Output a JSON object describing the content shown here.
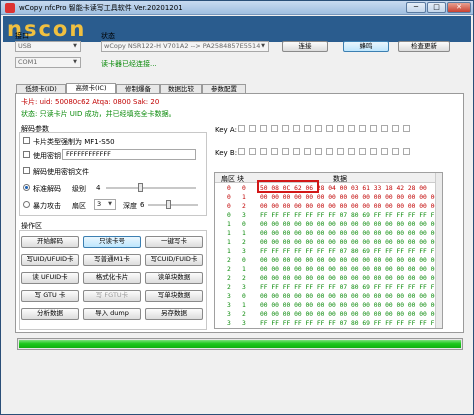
{
  "window": {
    "title": "wCopy nfcPro 智能卡读写工具软件  Ver.20201201",
    "minimize": "─",
    "maximize": "□",
    "close": "✕"
  },
  "banner": {
    "logo": "nscon"
  },
  "connection": {
    "port_label": "接口",
    "port_value": "USB",
    "com_value": "COM1",
    "status_label": "状态",
    "reader_value": "wCopy NSR122-H V701A2 --> PA2584857E5514",
    "reader_status": "读卡器已经连接...",
    "connect_label": "连接",
    "beep_label": "蜂鸣",
    "update_label": "检查更新"
  },
  "tabs": [
    "低频卡(ID)",
    "高频卡(IC)",
    "修制爆备",
    "数据比较",
    "参数配置"
  ],
  "card_info": {
    "line1": "卡片: uid: 50080c62  Atqa: 0800  Sak: 20",
    "line2": "状态: 只读卡片 UID 成功，并已经填充全卡数据。"
  },
  "decode_params": {
    "title": "解码参数",
    "opt1": "卡片类型强制为 MF1-S50",
    "opt2": "使用密钥",
    "key_value": "FFFFFFFFFFFF",
    "opt3": "解码使用密钥文件",
    "mode1": "标准解码",
    "level_label": "级别",
    "level_value": "4",
    "mode2": "暴力攻击",
    "sector_label": "扇区",
    "sector_value": "3",
    "depth_label": "深度",
    "depth_value": "6"
  },
  "operations": {
    "title": "操作区",
    "buttons": [
      [
        "开始解码",
        "只读卡号",
        "一键写卡"
      ],
      [
        "写UID/UFUID卡",
        "写普通M1卡",
        "写CUID/FUID卡"
      ],
      [
        "读 UFUID卡",
        "格式化卡片",
        "读单块数据"
      ],
      [
        "写 GTU 卡",
        "写 FGTU卡",
        "写单块数据"
      ],
      [
        "分析数据",
        "导入 dump",
        "另存数据"
      ]
    ]
  },
  "keys": {
    "a_label": "Key A:",
    "b_label": "Key B:"
  },
  "table": {
    "headers": [
      "扇区",
      "块",
      "数据"
    ],
    "rows": [
      {
        "sector": "0",
        "block": "0",
        "data": "50 08 0C 62 06 28 04 00 03 61 33 18 42 28 00",
        "color": "red"
      },
      {
        "sector": "0",
        "block": "1",
        "data": "00 00 00 00 00 00 00 00 00 00 00 00 00 00 00 00",
        "color": "red"
      },
      {
        "sector": "0",
        "block": "2",
        "data": "00 00 00 00 00 00 00 00 00 00 00 00 00 00 00 00",
        "color": "red"
      },
      {
        "sector": "0",
        "block": "3",
        "data": "FF FF FF FF FF FF FF 07 80 69 FF FF FF FF FF FF",
        "color": "green"
      },
      {
        "sector": "1",
        "block": "0",
        "data": "00 00 00 00 00 00 00 00 00 00 00 00 00 00 00 00",
        "color": "green"
      },
      {
        "sector": "1",
        "block": "1",
        "data": "00 00 00 00 00 00 00 00 00 00 00 00 00 00 00 00",
        "color": "green"
      },
      {
        "sector": "1",
        "block": "2",
        "data": "00 00 00 00 00 00 00 00 00 00 00 00 00 00 00 00",
        "color": "green"
      },
      {
        "sector": "1",
        "block": "3",
        "data": "FF FF FF FF FF FF FF 07 80 69 FF FF FF FF FF FF",
        "color": "green"
      },
      {
        "sector": "2",
        "block": "0",
        "data": "00 00 00 00 00 00 00 00 00 00 00 00 00 00 00 00",
        "color": "green"
      },
      {
        "sector": "2",
        "block": "1",
        "data": "00 00 00 00 00 00 00 00 00 00 00 00 00 00 00 00",
        "color": "green"
      },
      {
        "sector": "2",
        "block": "2",
        "data": "00 00 00 00 00 00 00 00 00 00 00 00 00 00 00 00",
        "color": "green"
      },
      {
        "sector": "2",
        "block": "3",
        "data": "FF FF FF FF FF FF FF 07 80 69 FF FF FF FF FF FF",
        "color": "green"
      },
      {
        "sector": "3",
        "block": "0",
        "data": "00 00 00 00 00 00 00 00 00 00 00 00 00 00 00 00",
        "color": "green"
      },
      {
        "sector": "3",
        "block": "1",
        "data": "00 00 00 00 00 00 00 00 00 00 00 00 00 00 00 00",
        "color": "green"
      },
      {
        "sector": "3",
        "block": "2",
        "data": "00 00 00 00 00 00 00 00 00 00 00 00 00 00 00 00",
        "color": "green"
      },
      {
        "sector": "3",
        "block": "3",
        "data": "FF FF FF FF FF FF FF 07 80 69 FF FF FF FF FF FF",
        "color": "green"
      }
    ]
  },
  "progress": {
    "value": 1.0
  },
  "colors": {
    "red": "#c00000",
    "green": "#0a8a0a",
    "highlight": "#d21818",
    "progress": "#1ec81e"
  }
}
